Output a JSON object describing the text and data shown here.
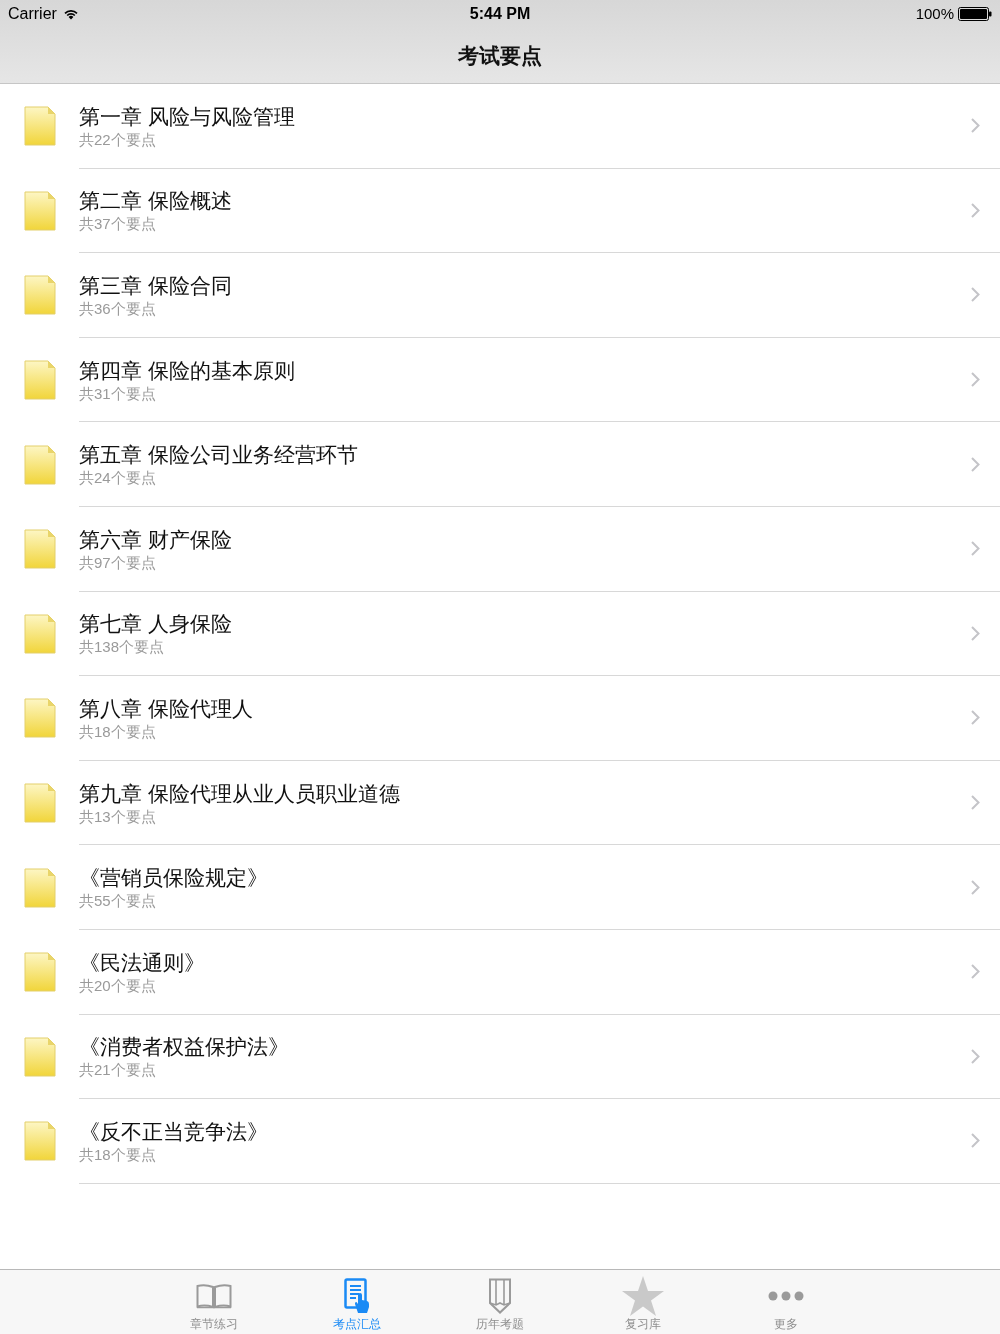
{
  "status_bar": {
    "carrier": "Carrier",
    "time": "5:44 PM",
    "battery": "100%"
  },
  "nav_bar": {
    "title": "考试要点"
  },
  "list": [
    {
      "title": "第一章 风险与风险管理",
      "subtitle": "共22个要点"
    },
    {
      "title": "第二章 保险概述",
      "subtitle": "共37个要点"
    },
    {
      "title": "第三章 保险合同",
      "subtitle": "共36个要点"
    },
    {
      "title": "第四章 保险的基本原则",
      "subtitle": "共31个要点"
    },
    {
      "title": "第五章 保险公司业务经营环节",
      "subtitle": "共24个要点"
    },
    {
      "title": "第六章 财产保险",
      "subtitle": "共97个要点"
    },
    {
      "title": "第七章 人身保险",
      "subtitle": "共138个要点"
    },
    {
      "title": "第八章 保险代理人",
      "subtitle": "共18个要点"
    },
    {
      "title": "第九章 保险代理从业人员职业道德",
      "subtitle": "共13个要点"
    },
    {
      "title": "《营销员保险规定》",
      "subtitle": "共55个要点"
    },
    {
      "title": "《民法通则》",
      "subtitle": "共20个要点"
    },
    {
      "title": "《消费者权益保护法》",
      "subtitle": "共21个要点"
    },
    {
      "title": "《反不正当竞争法》",
      "subtitle": "共18个要点"
    }
  ],
  "tab_bar": [
    {
      "label": "章节练习",
      "kind": "book",
      "selected": false
    },
    {
      "label": "考点汇总",
      "kind": "document",
      "selected": true
    },
    {
      "label": "历年考题",
      "kind": "pencil",
      "selected": false
    },
    {
      "label": "复习库",
      "kind": "star",
      "selected": false
    },
    {
      "label": "更多",
      "kind": "dots",
      "selected": false
    }
  ]
}
